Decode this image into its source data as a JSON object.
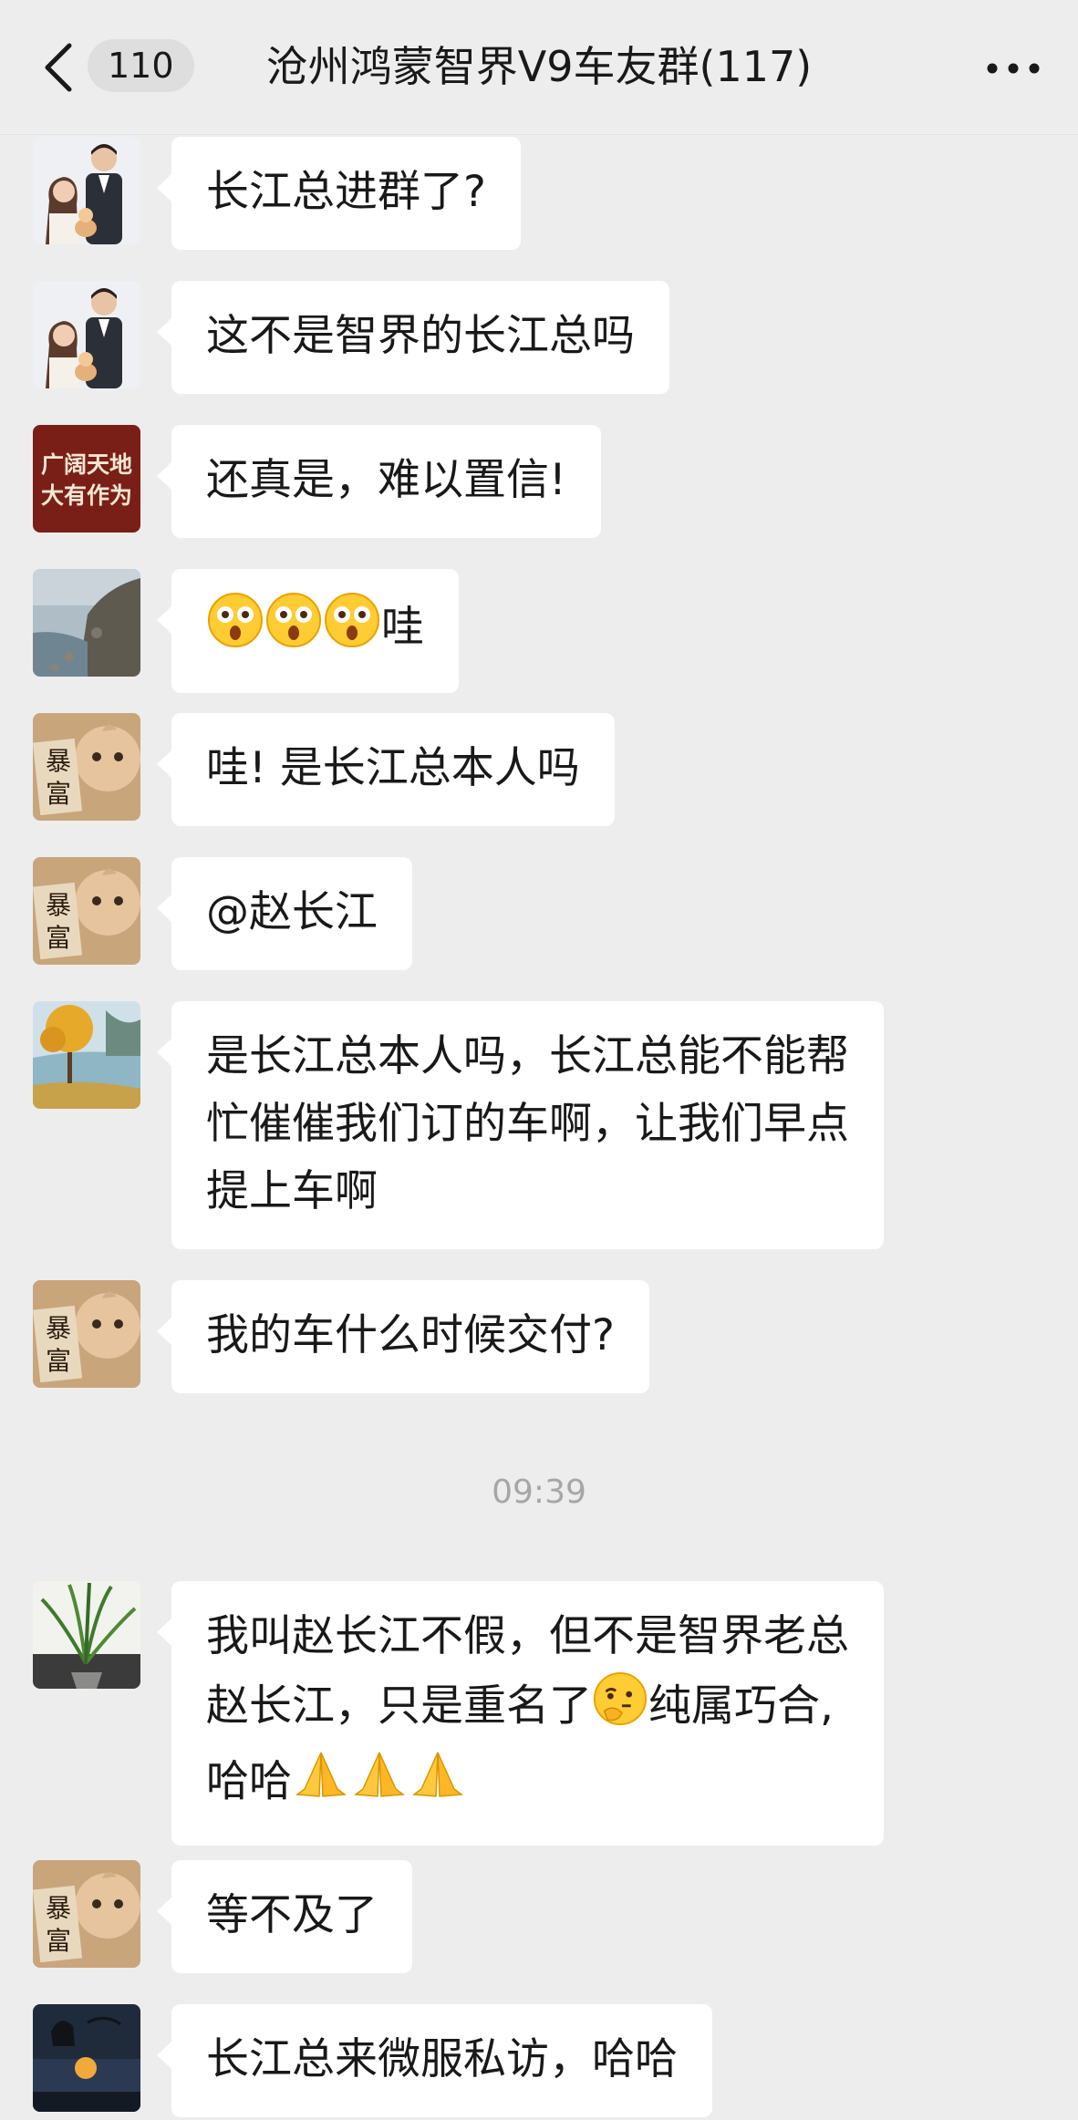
{
  "header": {
    "unread_count": "110",
    "title": "沧州鸿蒙智界V9车友群(117)"
  },
  "messages": [
    {
      "text": "长江总进群了?"
    },
    {
      "text": "这不是智界的长江总吗"
    },
    {
      "text": "还真是，难以置信!",
      "avatar_text": [
        "广阔天地",
        "大有作为"
      ]
    },
    {
      "emoji_prefix": [
        "astonished-emoji",
        "astonished-emoji",
        "astonished-emoji"
      ],
      "text": "哇"
    },
    {
      "text": "哇! 是长江总本人吗",
      "avatar_text": [
        "暴",
        "富"
      ]
    },
    {
      "text": "@赵长江",
      "avatar_text": [
        "暴",
        "富"
      ]
    },
    {
      "lines": [
        "是长江总本人吗，长江总能不能帮",
        "忙催催我们订的车啊，让我们早点",
        "提上车啊"
      ]
    },
    {
      "text": "我的车什么时候交付?",
      "avatar_text": [
        "暴",
        "富"
      ]
    },
    {
      "lines_a": "我叫赵长江不假，但不是智界老总",
      "line_b1": "赵长江，只是重名了",
      "line_b2": "纯属巧合,",
      "line_c": "哈哈",
      "emoji_names": [
        "thinking-emoji",
        "praying-hands-emoji"
      ]
    },
    {
      "text": "等不及了",
      "avatar_text": [
        "暴",
        "富"
      ]
    },
    {
      "text": "长江总来微服私访，哈哈"
    }
  ],
  "timestamp": "09:39",
  "colors": {
    "background": "#ededed",
    "bubble": "#ffffff",
    "timestamp": "#a6a6a6",
    "badge": "#dedede"
  }
}
